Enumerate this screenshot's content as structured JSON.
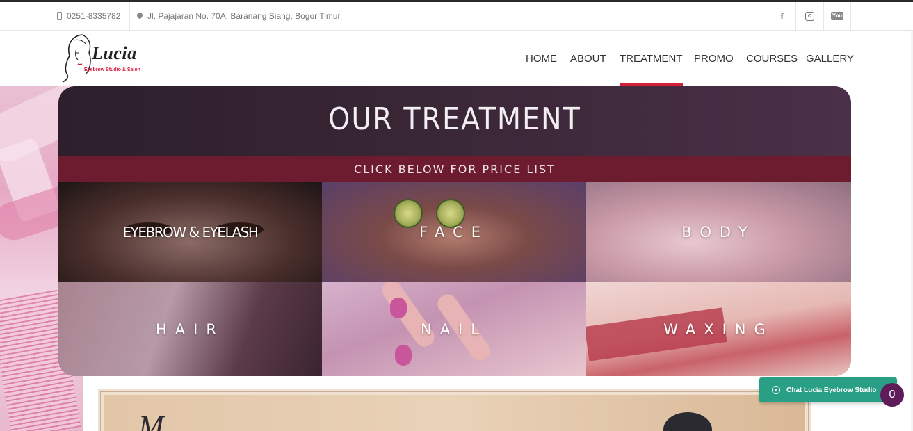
{
  "topbar": {
    "phone": "0251-8335782",
    "address": "Jl. Pajajaran No. 70A, Baranang Siang, Bogor Timur",
    "social": [
      {
        "name": "facebook",
        "glyph": "f"
      },
      {
        "name": "instagram"
      },
      {
        "name": "youtube",
        "glyph": "You"
      }
    ]
  },
  "header": {
    "logo": {
      "name": "Lucia",
      "tagline": "Eyebrow Studio & Salon"
    },
    "nav": [
      {
        "label": "HOME",
        "active": false
      },
      {
        "label": "ABOUT",
        "active": false
      },
      {
        "label": "TREATMENT",
        "active": true
      },
      {
        "label": "PROMO",
        "active": false
      },
      {
        "label": "COURSES",
        "active": false
      },
      {
        "label": "GALLERY",
        "active": false
      }
    ],
    "accent_color": "#d41f38"
  },
  "treatment": {
    "title": "OUR TREATMENT",
    "subtitle": "CLICK BELOW FOR PRICE LIST",
    "tiles": [
      {
        "label": "EYEBROW & EYELASH"
      },
      {
        "label": "FACE"
      },
      {
        "label": "BODY"
      },
      {
        "label": "HAIR"
      },
      {
        "label": "NAIL"
      },
      {
        "label": "WAXING"
      }
    ]
  },
  "promo": {
    "script_text": "M"
  },
  "chat": {
    "label": "Chat Lucia Eyebrow Studio",
    "badge_count": "0",
    "color": "#29a085"
  }
}
